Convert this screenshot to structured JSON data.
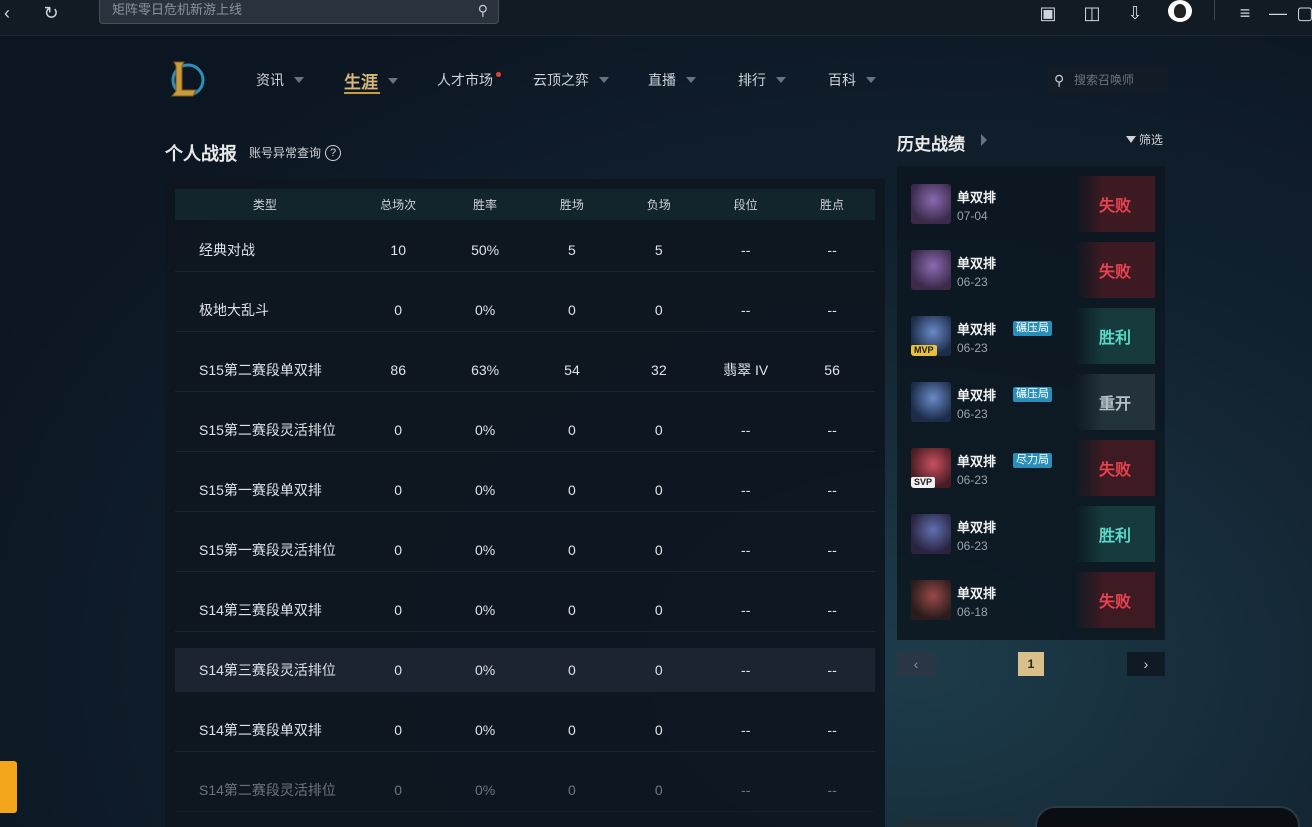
{
  "topbar": {
    "search_placeholder": "矩阵零日危机新游上线",
    "icons": [
      "back-icon",
      "refresh-icon",
      "game-controller-icon",
      "message-icon",
      "download-icon",
      "qq-avatar-icon",
      "menu-icon",
      "minimize-icon",
      "maximize-icon"
    ]
  },
  "nav": {
    "items": [
      {
        "label": "资讯"
      },
      {
        "label": "生涯"
      },
      {
        "label": "人才市场"
      },
      {
        "label": "云顶之弈"
      },
      {
        "label": "直播"
      },
      {
        "label": "排行"
      },
      {
        "label": "百科"
      }
    ],
    "search_placeholder": "搜索召唤师"
  },
  "stats": {
    "title": "个人战报",
    "abnormal_link": "账号异常查询",
    "help_glyph": "?",
    "headers": [
      "类型",
      "总场次",
      "胜率",
      "胜场",
      "负场",
      "段位",
      "胜点"
    ],
    "rows": [
      [
        "经典对战",
        "10",
        "50%",
        "5",
        "5",
        "--",
        "--"
      ],
      [
        "极地大乱斗",
        "0",
        "0%",
        "0",
        "0",
        "--",
        "--"
      ],
      [
        "S15第二赛段单双排",
        "86",
        "63%",
        "54",
        "32",
        "翡翠 IV",
        "56"
      ],
      [
        "S15第二赛段灵活排位",
        "0",
        "0%",
        "0",
        "0",
        "--",
        "--"
      ],
      [
        "S15第一赛段单双排",
        "0",
        "0%",
        "0",
        "0",
        "--",
        "--"
      ],
      [
        "S15第一赛段灵活排位",
        "0",
        "0%",
        "0",
        "0",
        "--",
        "--"
      ],
      [
        "S14第三赛段单双排",
        "0",
        "0%",
        "0",
        "0",
        "--",
        "--"
      ],
      [
        "S14第三赛段灵活排位",
        "0",
        "0%",
        "0",
        "0",
        "--",
        "--"
      ],
      [
        "S14第二赛段单双排",
        "0",
        "0%",
        "0",
        "0",
        "--",
        "--"
      ],
      [
        "S14第二赛段灵活排位",
        "0",
        "0%",
        "0",
        "0",
        "--",
        "--"
      ]
    ]
  },
  "history": {
    "title": "历史战绩",
    "filter_label": "筛选",
    "matches": [
      {
        "mode": "单双排",
        "date": "07-04",
        "result": "失败",
        "type": "lose",
        "tag": "",
        "badge": ""
      },
      {
        "mode": "单双排",
        "date": "06-23",
        "result": "失败",
        "type": "lose",
        "tag": "",
        "badge": ""
      },
      {
        "mode": "单双排",
        "date": "06-23",
        "result": "胜利",
        "type": "win",
        "tag": "碾压局",
        "badge": "MVP"
      },
      {
        "mode": "单双排",
        "date": "06-23",
        "result": "重开",
        "type": "remake",
        "tag": "碾压局",
        "badge": ""
      },
      {
        "mode": "单双排",
        "date": "06-23",
        "result": "失败",
        "type": "lose",
        "tag": "尽力局",
        "badge": "SVP"
      },
      {
        "mode": "单双排",
        "date": "06-23",
        "result": "胜利",
        "type": "win",
        "tag": "",
        "badge": ""
      },
      {
        "mode": "单双排",
        "date": "06-18",
        "result": "失败",
        "type": "lose",
        "tag": "",
        "badge": ""
      }
    ],
    "page": "1"
  },
  "colors": {
    "accent_gold": "#c89b3c",
    "lose": "#e8414f",
    "win": "#59d9c8"
  }
}
